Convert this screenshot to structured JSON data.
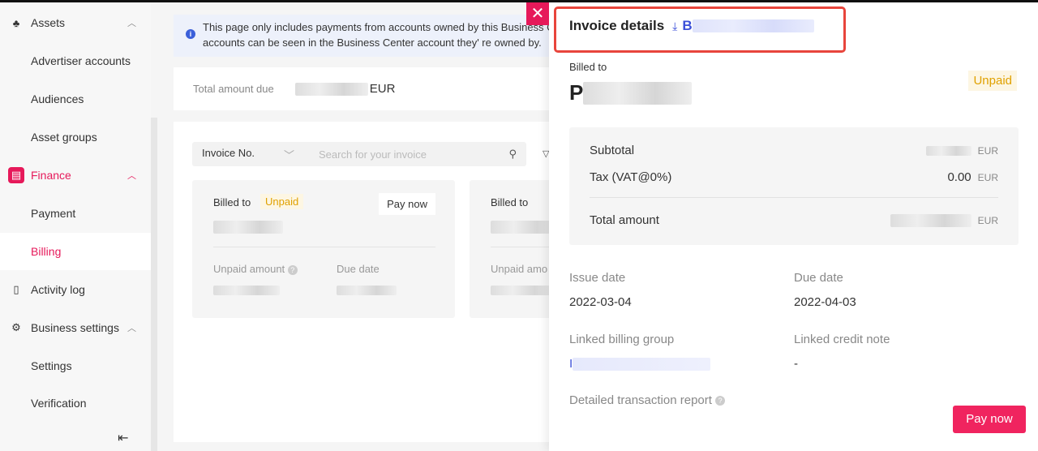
{
  "sidebar": {
    "assets": "Assets",
    "advertiser_accounts": "Advertiser accounts",
    "audiences": "Audiences",
    "asset_groups": "Asset groups",
    "finance": "Finance",
    "payment": "Payment",
    "billing": "Billing",
    "activity_log": "Activity log",
    "business_settings": "Business settings",
    "settings": "Settings",
    "verification": "Verification"
  },
  "main": {
    "notice": "This page only includes payments from accounts owned by this Business Center. Other accounts can be seen in the Business Center account they' re owned by.",
    "notice_line1": "This page only includes payments from accounts owned by this Business",
    "notice_line2": "accounts can be seen in the Business Center account they'  re owned by.",
    "total_label": "Total amount due",
    "total_currency": "EUR",
    "search_type": "Invoice No.",
    "search_placeholder": "Search for your invoice",
    "cards": [
      {
        "billed_to": "Billed to",
        "status": "Unpaid",
        "pay": "Pay now",
        "unpaid_amount": "Unpaid amount",
        "due_date": "Due date"
      },
      {
        "billed_to": "Billed to",
        "unpaid_amount": "Unpaid amo"
      }
    ]
  },
  "drawer": {
    "title": "Invoice details",
    "invoice_prefix": "B",
    "billed_to": "Billed to",
    "name_initial": "P",
    "status": "Unpaid",
    "subtotal": "Subtotal",
    "tax": "Tax (VAT@0%)",
    "tax_value": "0.00",
    "total": "Total amount",
    "currency": "EUR",
    "issue_date_label": "Issue date",
    "issue_date": "2022-03-04",
    "due_date_label": "Due date",
    "due_date": "2022-04-03",
    "billing_group_label": "Linked billing group",
    "billing_group_prefix": "I",
    "credit_note_label": "Linked credit note",
    "credit_note": "-",
    "report_label": "Detailed transaction report",
    "pay_now": "Pay now"
  },
  "colors": {
    "accent": "#e6195a",
    "highlight": "#e8453c",
    "link": "#3b4fd9",
    "unpaid": "#e0a100"
  }
}
